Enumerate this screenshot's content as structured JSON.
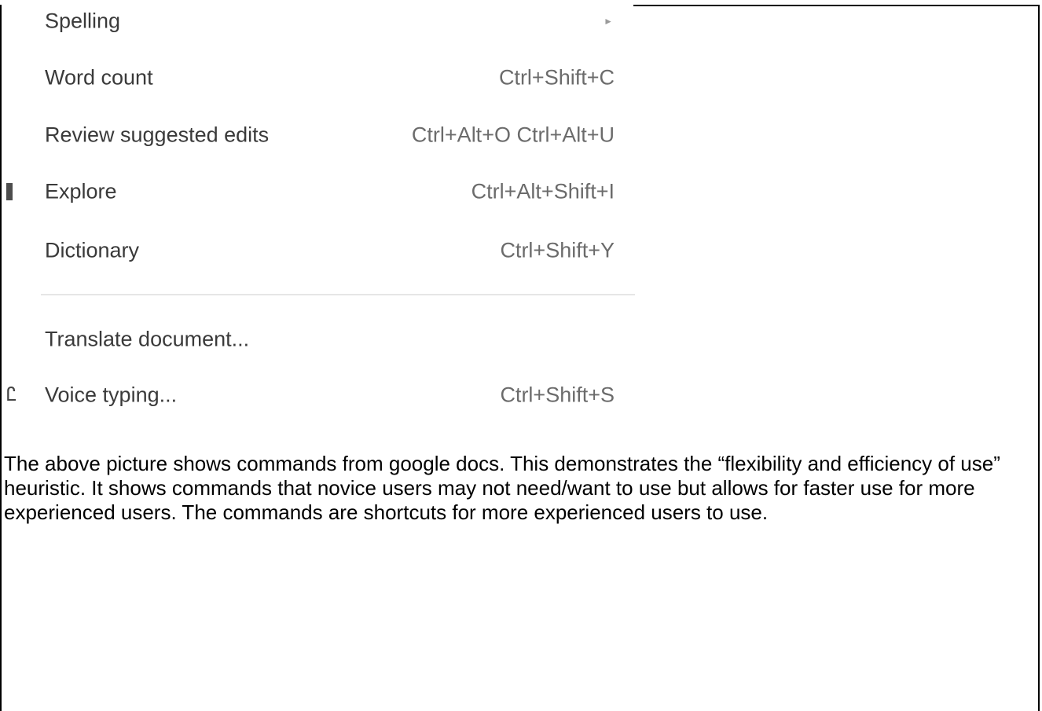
{
  "menu": {
    "items": [
      {
        "label": "Spelling",
        "shortcut": "",
        "submenu": true,
        "icon": ""
      },
      {
        "label": "Word count",
        "shortcut": "Ctrl+Shift+C",
        "submenu": false,
        "icon": ""
      },
      {
        "label": "Review suggested edits",
        "shortcut": "Ctrl+Alt+O Ctrl+Alt+U",
        "submenu": false,
        "icon": ""
      },
      {
        "label": "Explore",
        "shortcut": "Ctrl+Alt+Shift+I",
        "submenu": false,
        "icon": "explore-icon"
      },
      {
        "label": "Dictionary",
        "shortcut": "Ctrl+Shift+Y",
        "submenu": false,
        "icon": ""
      },
      {
        "label": "Translate document...",
        "shortcut": "",
        "submenu": false,
        "icon": ""
      },
      {
        "label": "Voice typing...",
        "shortcut": "Ctrl+Shift+S",
        "submenu": false,
        "icon": "microphone-icon"
      }
    ],
    "submenu_arrow_glyph": "►",
    "voice_icon_glyph": "Ꮭ"
  },
  "caption": {
    "text": "The above picture shows commands from google docs. This demonstrates the “flexibility and efficiency of use” heuristic. It shows commands that novice users may not need/want to use but allows for faster use for more experienced users. The commands are shortcuts for more experienced users to use."
  }
}
